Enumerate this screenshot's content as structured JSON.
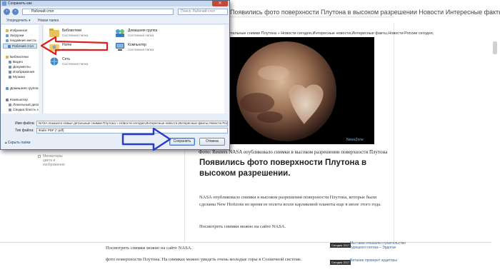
{
  "browser_page": {
    "page_title": "Появились фото поверхности Плутона в высоком разрешении Новости Интересные факты,Новости России сегодня,",
    "image_lead": "NASA показало новые детальные снимки Плутона » Новости сегодня,Интересные новости,Интересные факты,Новости России сегодня,",
    "photo_watermark": "NewsZone",
    "caption": "Фото: Reuters NASA опубликовало снимки в высоком разрешении поверхности Плутона",
    "headline": "Появились фото поверхности Плутона в высоком разрешении.",
    "paragraph1": "NASA опубликовало снимки в высоком разрешении поверхности Плутона, которые были сделаны New Horizons во время ее полета возле карликовой планеты еще в июле этого года.",
    "paragraph2": "Посмотреть снимки можно на сайте NASA.",
    "bottom_line1": "Посмотреть снимки можно на сайте NASA.",
    "bottom_line2": "фото поверхности Плутона. На снимках можно увидеть очень молодые горы в Солнечной системе.",
    "side_text": "Миниатюры цвета и изображения",
    "related_news": [
      {
        "date": "Сегодня 2017",
        "text": "Мы сами отказали строительство турецкого потока – Эрдоган"
      },
      {
        "date": "Сегодня 2017",
        "text": "Витание проверит аудиторы"
      }
    ]
  },
  "dialog": {
    "title": "Сохранить как",
    "address": "Рабочий стол",
    "search_placeholder": "Поиск: Рабочий стол",
    "toolbar": {
      "organize": "Упорядочить ▾",
      "new_folder": "Новая папка"
    },
    "nav_items": [
      {
        "label": "Избранное",
        "color": "#e0b53a"
      },
      {
        "label": "Загрузки",
        "color": "#6a9fd6"
      },
      {
        "label": "Недавние места",
        "color": "#6a9fd6"
      },
      {
        "label": "Рабочий стол",
        "color": "#4c7fc4",
        "selected": true
      },
      {
        "label": "Библиотеки",
        "color": "#d9b24c"
      },
      {
        "label": "Видео",
        "color": "#7a8fa8"
      },
      {
        "label": "Документы",
        "color": "#7a8fa8"
      },
      {
        "label": "Изображения",
        "color": "#7a8fa8"
      },
      {
        "label": "Музыка",
        "color": "#7a8fa8"
      },
      {
        "label": "Домашняя группа",
        "color": "#4ea0d9"
      },
      {
        "label": "Компьютер",
        "color": "#6e7f95"
      },
      {
        "label": "Локальный диск",
        "color": "#8a96a6"
      },
      {
        "label": "Сводка блесть не",
        "color": "#8a96a6"
      }
    ],
    "files": [
      {
        "name": "Библиотеки",
        "type": "Системная папка",
        "icon": "library-icon"
      },
      {
        "name": "Домашняя группа",
        "type": "Системная папка",
        "icon": "homegroup-icon"
      },
      {
        "name": "Home",
        "type": "Системная папка",
        "icon": "user-folder-icon"
      },
      {
        "name": "Компьютер",
        "type": "Системная папка",
        "icon": "computer-icon"
      },
      {
        "name": "Сеть",
        "type": "Системная папка",
        "icon": "network-icon"
      }
    ],
    "filename_label": "Имя файла:",
    "filename_value": "NASA показало новые детальные снимки Плутона » Новости сегодня,Интересные новости,Интересные факты,Новости России",
    "filetype_label": "Тип файла:",
    "filetype_value": "Файл PDF (*.pdf)",
    "hide_folders": "Скрыть папки",
    "save_button": "Сохранить",
    "cancel_button": "Отмена"
  },
  "annotation_colors": {
    "red_arrow": "#e02020",
    "blue_arrow": "#2a3cc8"
  }
}
